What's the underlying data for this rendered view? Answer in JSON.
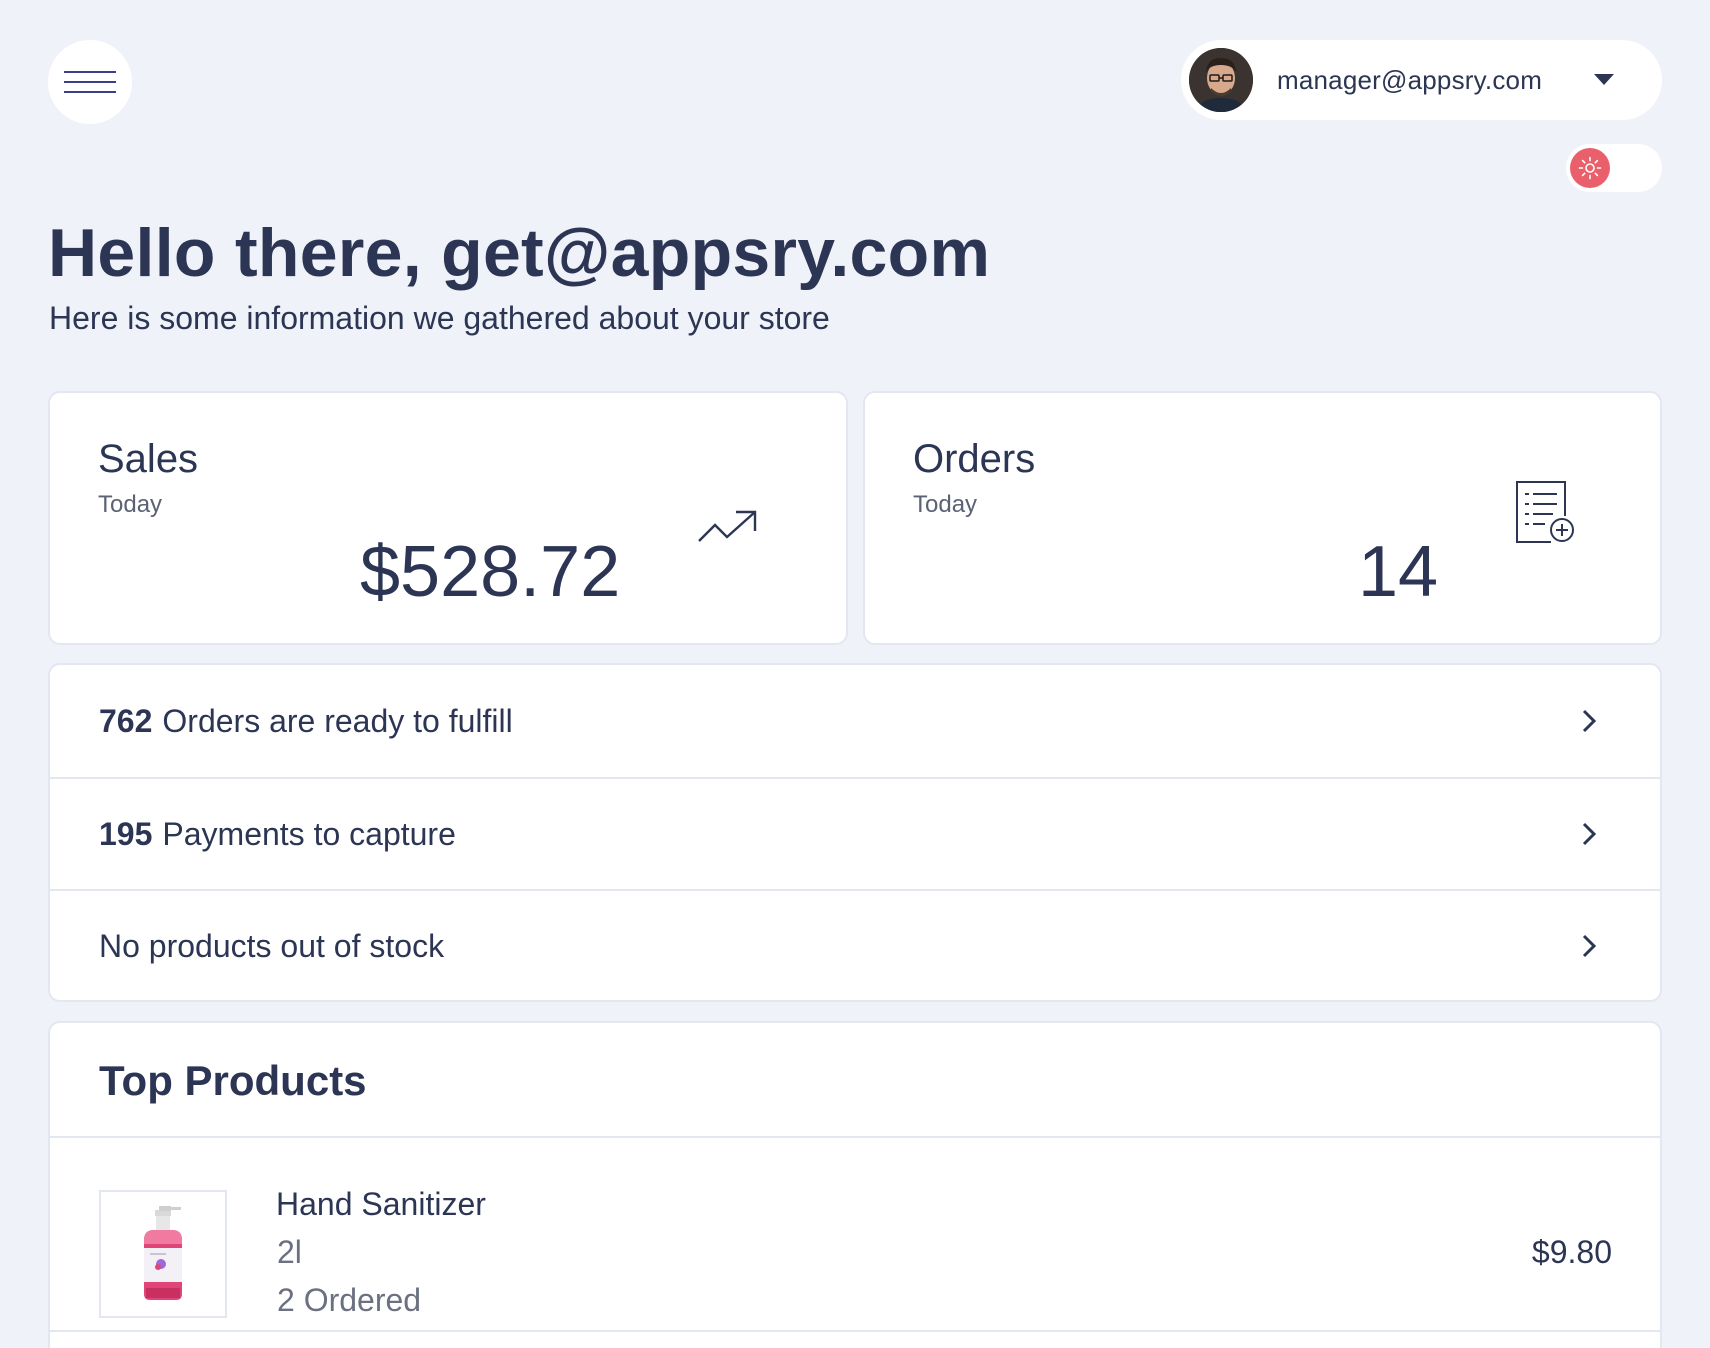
{
  "header": {
    "menu_icon": "hamburger-menu-icon",
    "user_email": "manager@appsry.com",
    "dropdown_icon": "caret-down-icon",
    "theme_toggle_icon": "sun-icon"
  },
  "greeting": {
    "title": "Hello there, get@appsry.com",
    "subtitle": "Here is some information we gathered about your store"
  },
  "stats": {
    "sales": {
      "title": "Sales",
      "period": "Today",
      "value": "$528.72",
      "icon": "trending-up-icon"
    },
    "orders": {
      "title": "Orders",
      "period": "Today",
      "value": "14",
      "icon": "order-list-add-icon"
    }
  },
  "summary": [
    {
      "count": "762",
      "label": "Orders are ready to fulfill"
    },
    {
      "count": "195",
      "label": "Payments to capture"
    },
    {
      "count": "",
      "label": "No products out of stock"
    }
  ],
  "top_products": {
    "title": "Top Products",
    "items": [
      {
        "name": "Hand Sanitizer",
        "variant": "2l",
        "ordered": "2 Ordered",
        "price": "$9.80"
      }
    ]
  },
  "colors": {
    "background": "#eff2f8",
    "text": "#2c3654",
    "accent_toggle": "#e9606c",
    "product_pink": "#e0457a"
  }
}
